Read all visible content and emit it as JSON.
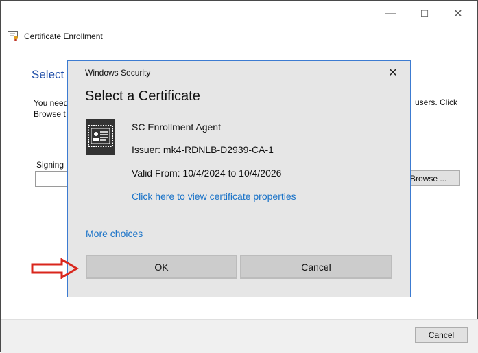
{
  "outer_window": {
    "header_title": "Certificate Enrollment",
    "heading_partial": "Select E",
    "body_line1_partial": "You need",
    "body_line2_partial": "Browse t",
    "body_right_partial": "users. Click",
    "signing_label_partial": "Signing",
    "browse_label_partial": "Browse ...",
    "cancel_label": "Cancel",
    "minimize_glyph": "—",
    "maximize_glyph": "☐",
    "close_glyph": "✕"
  },
  "dialog": {
    "caption": "Windows Security",
    "close_glyph": "✕",
    "title": "Select a Certificate",
    "certificate": {
      "name": "SC Enrollment Agent",
      "issuer": "Issuer: mk4-RDNLB-D2939-CA-1",
      "valid": "Valid From: 10/4/2024 to 10/4/2026",
      "properties_link": "Click here to view certificate properties"
    },
    "more_choices": "More choices",
    "ok_label": "OK",
    "cancel_label": "Cancel"
  },
  "colors": {
    "link": "#1a73c8",
    "dialog_border": "#3c7bd1",
    "annotation_arrow": "#d9261c"
  }
}
